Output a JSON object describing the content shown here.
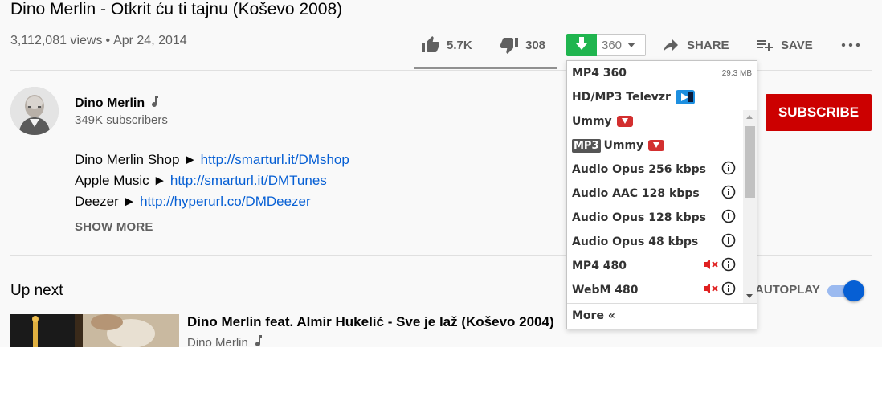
{
  "video": {
    "title": "Dino Merlin - Otkrit ću ti tajnu (Koševo 2008)",
    "views": "3,112,081 views",
    "separator": "•",
    "date": "Apr 24, 2014"
  },
  "actions": {
    "like_count": "5.7K",
    "dislike_count": "308",
    "like_ratio": 0.95,
    "quality_selected": "360",
    "share_label": "SHARE",
    "save_label": "SAVE"
  },
  "channel": {
    "name": "Dino Merlin",
    "subscribers": "349K subscribers",
    "subscribe_label": "SUBSCRIBE"
  },
  "description": {
    "lines": [
      {
        "text": "Dino Merlin Shop ► ",
        "link": "http://smarturl.it/DMshop"
      },
      {
        "text": "Apple Music ► ",
        "link": "http://smarturl.it/DMTunes"
      },
      {
        "text": "Deezer ► ",
        "link": "http://hyperurl.co/DMDeezer"
      }
    ],
    "show_more": "SHOW MORE"
  },
  "upnext": {
    "heading": "Up next",
    "autoplay_label": "AUTOPLAY",
    "autoplay_on": true,
    "item": {
      "title": "Dino Merlin feat. Almir Hukelić - Sve je laž (Koševo 2004)",
      "channel": "Dino Merlin"
    }
  },
  "download_menu": {
    "items": [
      {
        "label": "MP4 360",
        "size": "29.3 MB"
      },
      {
        "label": "HD/MP3 Televzr"
      },
      {
        "label": "Ummy"
      },
      {
        "tag": "MP3",
        "label": "Ummy"
      },
      {
        "label": "Audio Opus 256 kbps"
      },
      {
        "label": "Audio AAC 128 kbps"
      },
      {
        "label": "Audio Opus 128 kbps"
      },
      {
        "label": "Audio Opus 48 kbps"
      },
      {
        "label": "MP4 480"
      },
      {
        "label": "WebM 480"
      }
    ],
    "more_label": "More «"
  },
  "colors": {
    "download_green": "#20b54f",
    "subscribe_red": "#cc0000",
    "link_blue": "#065fd4",
    "ummy_red": "#d32f2f"
  },
  "icons": [
    "thumbs-up-icon",
    "thumbs-down-icon",
    "download-arrow-icon",
    "share-arrow-icon",
    "playlist-add-icon",
    "more-dots-icon",
    "music-note-icon",
    "info-icon",
    "muted-speaker-icon",
    "televzr-icon",
    "ummy-download-icon"
  ]
}
